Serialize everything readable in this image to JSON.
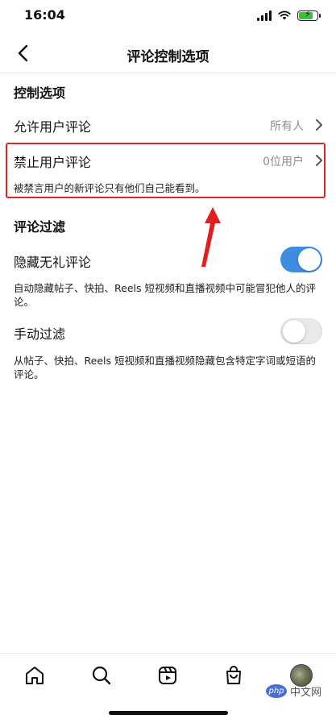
{
  "status_bar": {
    "time": "16:04",
    "battery_charge": 0.8
  },
  "nav": {
    "title": "评论控制选项"
  },
  "controls": {
    "section_title": "控制选项",
    "allow": {
      "label": "允许用户评论",
      "value": "所有人"
    },
    "block": {
      "label": "禁止用户评论",
      "value": "0位用户",
      "note": "被禁言用户的新评论只有他们自己能看到。"
    }
  },
  "filter": {
    "section_title": "评论过滤",
    "hide_offensive": {
      "label": "隐藏无礼评论",
      "enabled": true,
      "note": "自动隐藏帖子、快拍、Reels 短视频和直播视频中可能冒犯他人的评论。"
    },
    "manual": {
      "label": "手动过滤",
      "enabled": false,
      "note": "从帖子、快拍、Reels 短视频和直播视频隐藏包含特定字词或短语的评论。"
    }
  },
  "tab_bar": {
    "icons": [
      "home-icon",
      "search-icon",
      "reels-icon",
      "shop-icon",
      "profile-avatar"
    ]
  },
  "colors": {
    "toggle_on": "#3d8ee3",
    "highlight": "#d62828",
    "accent_arrow": "#e02020"
  },
  "watermark": {
    "badge": "php",
    "text": "中文网"
  }
}
